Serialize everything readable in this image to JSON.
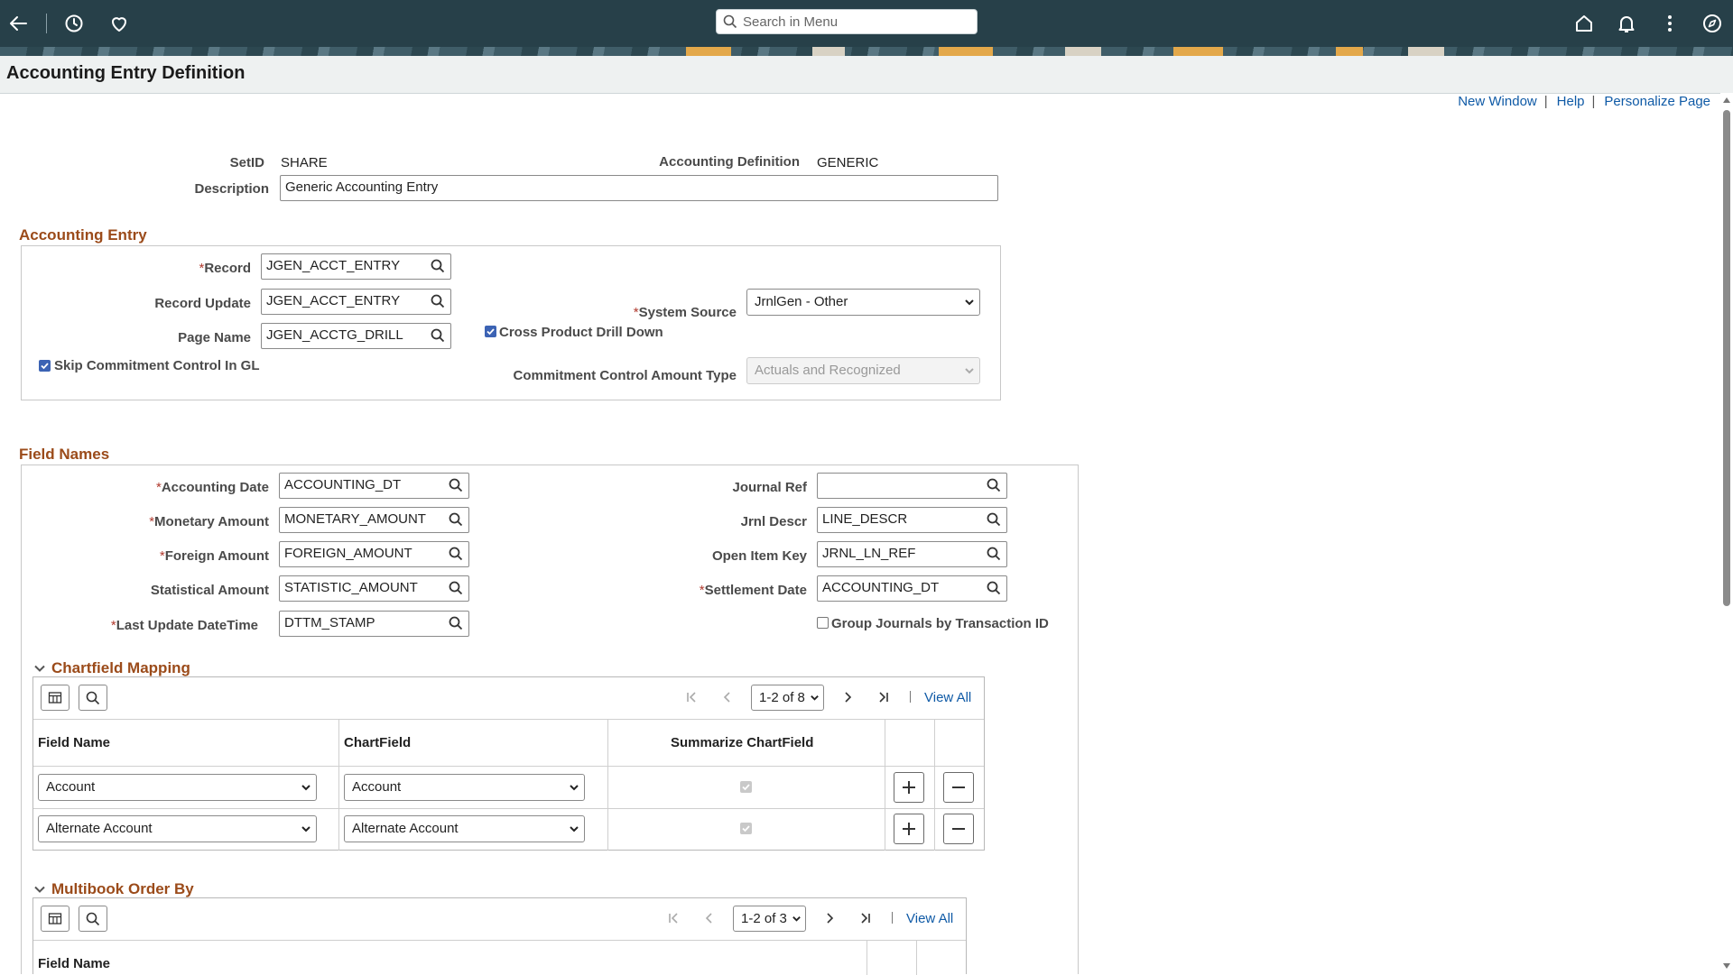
{
  "toolbar": {
    "search_placeholder": "Search in Menu",
    "icons": [
      "back-icon",
      "history-icon",
      "favorites-icon",
      "home-icon",
      "notifications-icon",
      "actions-icon",
      "navigator-icon"
    ]
  },
  "page": {
    "title": "Accounting Entry Definition",
    "links": {
      "new_window": "New Window",
      "help": "Help",
      "personalize": "Personalize Page"
    }
  },
  "header": {
    "setid_label": "SetID",
    "setid_value": "SHARE",
    "acct_def_label": "Accounting Definition",
    "acct_def_value": "GENERIC",
    "description_label": "Description",
    "description_value": "Generic Accounting Entry"
  },
  "accounting_entry": {
    "title": "Accounting Entry",
    "required_mark": "*",
    "record_label": "Record",
    "record_value": "JGEN_ACCT_ENTRY",
    "record_update_label": "Record Update",
    "record_update_value": "JGEN_ACCT_ENTRY",
    "page_name_label": "Page Name",
    "page_name_value": "JGEN_ACCTG_DRILL",
    "skip_cc_label": "Skip Commitment Control In GL",
    "system_source_label": "System Source",
    "system_source_value": "JrnlGen - Other",
    "cross_product_label": "Cross Product Drill Down",
    "cc_amount_type_label": "Commitment Control Amount Type",
    "cc_amount_type_value": "Actuals and Recognized"
  },
  "field_names": {
    "title": "Field Names",
    "required_mark": "*",
    "accounting_date_label": "Accounting Date",
    "accounting_date_value": "ACCOUNTING_DT",
    "monetary_amount_label": "Monetary Amount",
    "monetary_amount_value": "MONETARY_AMOUNT",
    "foreign_amount_label": "Foreign Amount",
    "foreign_amount_value": "FOREIGN_AMOUNT",
    "statistical_amount_label": "Statistical Amount",
    "statistical_amount_value": "STATISTIC_AMOUNT",
    "last_update_label": "Last Update DateTime",
    "last_update_value": "DTTM_STAMP",
    "journal_ref_label": "Journal Ref",
    "journal_ref_value": "",
    "jrnl_descr_label": "Jrnl Descr",
    "jrnl_descr_value": "LINE_DESCR",
    "open_item_key_label": "Open Item Key",
    "open_item_key_value": "JRNL_LN_REF",
    "settlement_date_label": "Settlement Date",
    "settlement_date_value": "ACCOUNTING_DT",
    "group_journals_label": "Group Journals by Transaction ID"
  },
  "chartfield_mapping": {
    "title": "Chartfield Mapping",
    "pager": "1-2 of 8",
    "view_all": "View All",
    "columns": [
      "Field Name",
      "ChartField",
      "Summarize ChartField"
    ],
    "rows": [
      {
        "field_name": "Account",
        "chartfield": "Account",
        "summarize": true
      },
      {
        "field_name": "Alternate Account",
        "chartfield": "Alternate Account",
        "summarize": true
      }
    ]
  },
  "multibook_order_by": {
    "title": "Multibook Order By",
    "pager": "1-2 of 3",
    "view_all": "View All",
    "columns": [
      "Field Name"
    ]
  }
}
